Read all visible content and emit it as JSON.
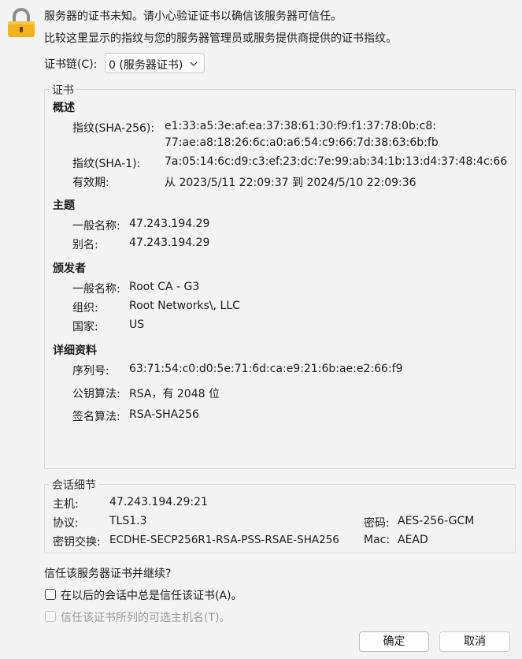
{
  "header": {
    "line1": "服务器的证书未知。请小心验证证书以确信该服务器可信任。",
    "line2": "比较这里显示的指纹与您的服务器管理员或服务提供商提供的证书指纹。"
  },
  "chain": {
    "label": "证书链(C):",
    "value": "0 (服务器证书)"
  },
  "cert": {
    "group_title": "证书",
    "overview_title": "概述",
    "sha256_label": "指纹(SHA-256):",
    "sha256_line1": "e1:33:a5:3e:af:ea:37:38:61:30:f9:f1:37:78:0b:c8:",
    "sha256_line2": "77:ae:a8:18:26:6c:a0:a6:54:c9:66:7d:38:63:6b:fb",
    "sha1_label": "指纹(SHA-1):",
    "sha1_value": "7a:05:14:6c:d9:c3:ef:23:dc:7e:99:ab:34:1b:13:d4:37:48:4c:66",
    "validity_label": "有效期:",
    "validity_value": "从 2023/5/11 22:09:37 到 2024/5/10 22:09:36",
    "subject_title": "主题",
    "subject_cn_label": "一般名称:",
    "subject_cn_value": "47.243.194.29",
    "subject_alt_label": "别名:",
    "subject_alt_value": "47.243.194.29",
    "issuer_title": "颁发者",
    "issuer_cn_label": "一般名称:",
    "issuer_cn_value": "Root CA - G3",
    "issuer_org_label": "组织:",
    "issuer_org_value": "Root Networks\\, LLC",
    "issuer_country_label": "国家:",
    "issuer_country_value": "US",
    "details_title": "详细资料",
    "serial_label": "序列号:",
    "serial_value": "63:71:54:c0:d0:5e:71:6d:ca:e9:21:6b:ae:e2:66:f9",
    "pubkey_label": "公钥算法:",
    "pubkey_value": "RSA，有 2048 位",
    "sig_label": "签名算法:",
    "sig_value": "RSA-SHA256"
  },
  "session": {
    "group_title": "会话细节",
    "host_label": "主机:",
    "host_value": "47.243.194.29:21",
    "protocol_label": "协议:",
    "protocol_value": "TLS1.3",
    "cipher_label": "密码:",
    "cipher_value": "AES-256-GCM",
    "kex_label": "密钥交换:",
    "kex_value": "ECDHE-SECP256R1-RSA-PSS-RSAE-SHA256",
    "mac_label": "Mac:",
    "mac_value": "AEAD"
  },
  "trust": {
    "question": "信任该服务器证书并继续?",
    "always_label": "在以后的会话中总是信任该证书(A)。",
    "always_checked": false,
    "alt_names_label": "信任该证书所列的可选主机名(T)。",
    "alt_names_checked": false
  },
  "buttons": {
    "ok": "确定",
    "cancel": "取消"
  },
  "icons": {
    "lock": "padlock-icon",
    "dropdown": "chevron-down-icon"
  },
  "colors": {
    "lock_body": "#f2b21a",
    "lock_shackle": "#8d8d8d"
  }
}
